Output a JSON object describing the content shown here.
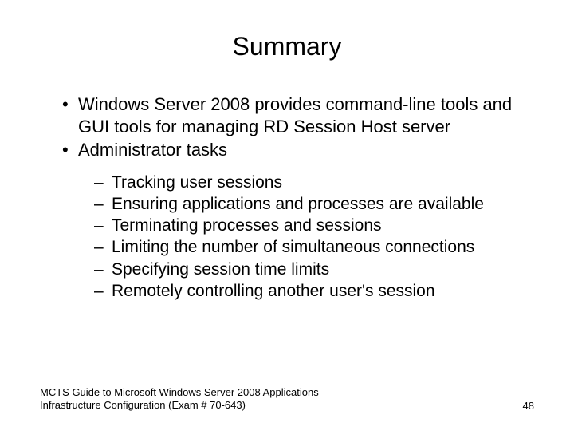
{
  "title": "Summary",
  "bullets": [
    "Windows Server 2008 provides command-line tools and GUI tools for managing RD Session Host server",
    "Administrator tasks"
  ],
  "subBullets": [
    "Tracking user sessions",
    "Ensuring applications and processes are available",
    "Terminating processes and sessions",
    "Limiting the number of simultaneous connections",
    "Specifying session time limits",
    "Remotely controlling another user's session"
  ],
  "footer": {
    "source": "MCTS Guide to Microsoft Windows Server 2008 Applications Infrastructure Configuration (Exam # 70-643)",
    "pageNumber": "48"
  }
}
